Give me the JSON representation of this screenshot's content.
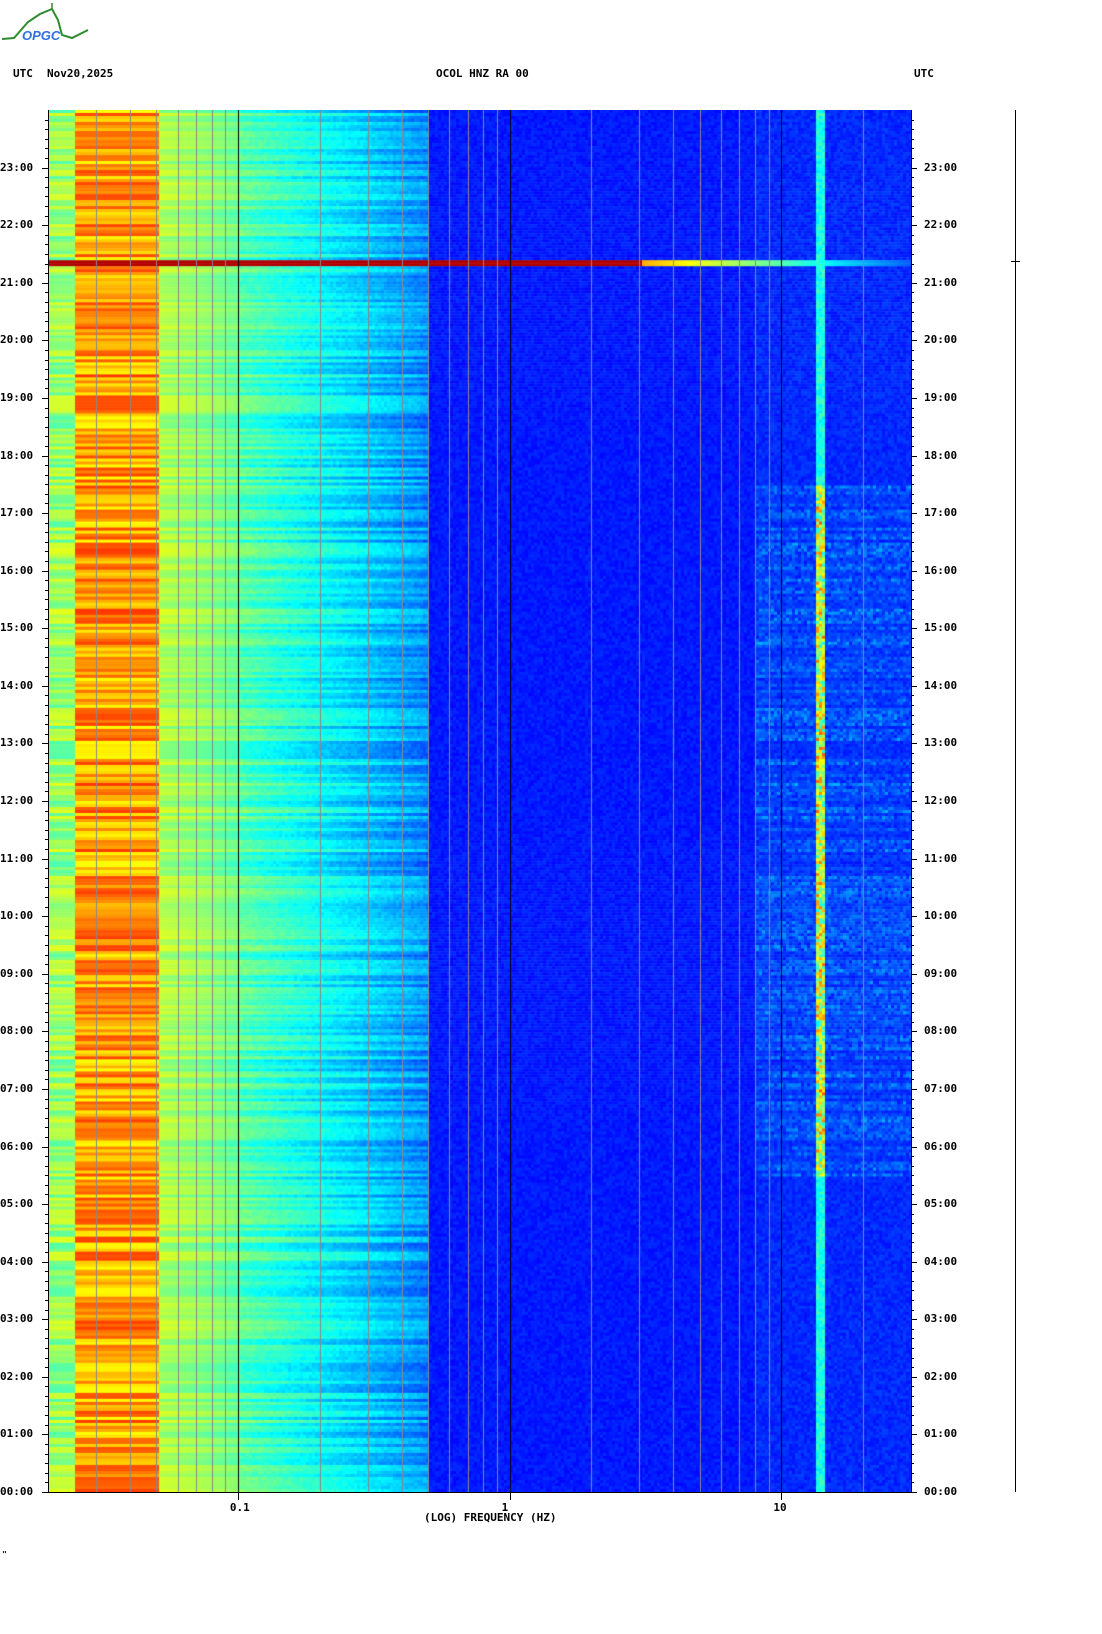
{
  "logo": {
    "text": "OPGC"
  },
  "header": {
    "left_tz": "UTC",
    "date": "Nov20,2025",
    "station": "OCOL HNZ RA 00",
    "right_tz": "UTC"
  },
  "chart_data": {
    "type": "heatmap",
    "title": "OCOL HNZ RA 00",
    "xlabel": "(LOG) FREQUENCY (HZ)",
    "ylabel": "UTC",
    "xscale": "log",
    "xlim": [
      0.02,
      30
    ],
    "ylim_hours": [
      0,
      24
    ],
    "x_ticks": [
      {
        "value": 0.1,
        "label": "0.1"
      },
      {
        "value": 1,
        "label": "1"
      },
      {
        "value": 10,
        "label": "10"
      }
    ],
    "y_ticks": [
      "00:00",
      "01:00",
      "02:00",
      "03:00",
      "04:00",
      "05:00",
      "06:00",
      "07:00",
      "08:00",
      "09:00",
      "10:00",
      "11:00",
      "12:00",
      "13:00",
      "14:00",
      "15:00",
      "16:00",
      "17:00",
      "18:00",
      "19:00",
      "20:00",
      "21:00",
      "22:00",
      "23:00"
    ],
    "colormap": "jet",
    "features": [
      {
        "description": "broadband event",
        "time_hours": 21.33,
        "freq_range_hz": [
          0.02,
          30
        ]
      },
      {
        "description": "persistent narrowband line",
        "freq_hz": 13.7
      },
      {
        "description": "high microseism energy",
        "freq_range_hz": [
          0.025,
          0.05
        ]
      },
      {
        "description": "daytime cultural noise",
        "freq_range_hz": [
          8,
          30
        ],
        "time_range_hours": [
          5.5,
          17.5
        ]
      }
    ]
  },
  "footer": {
    "mark": "\""
  }
}
